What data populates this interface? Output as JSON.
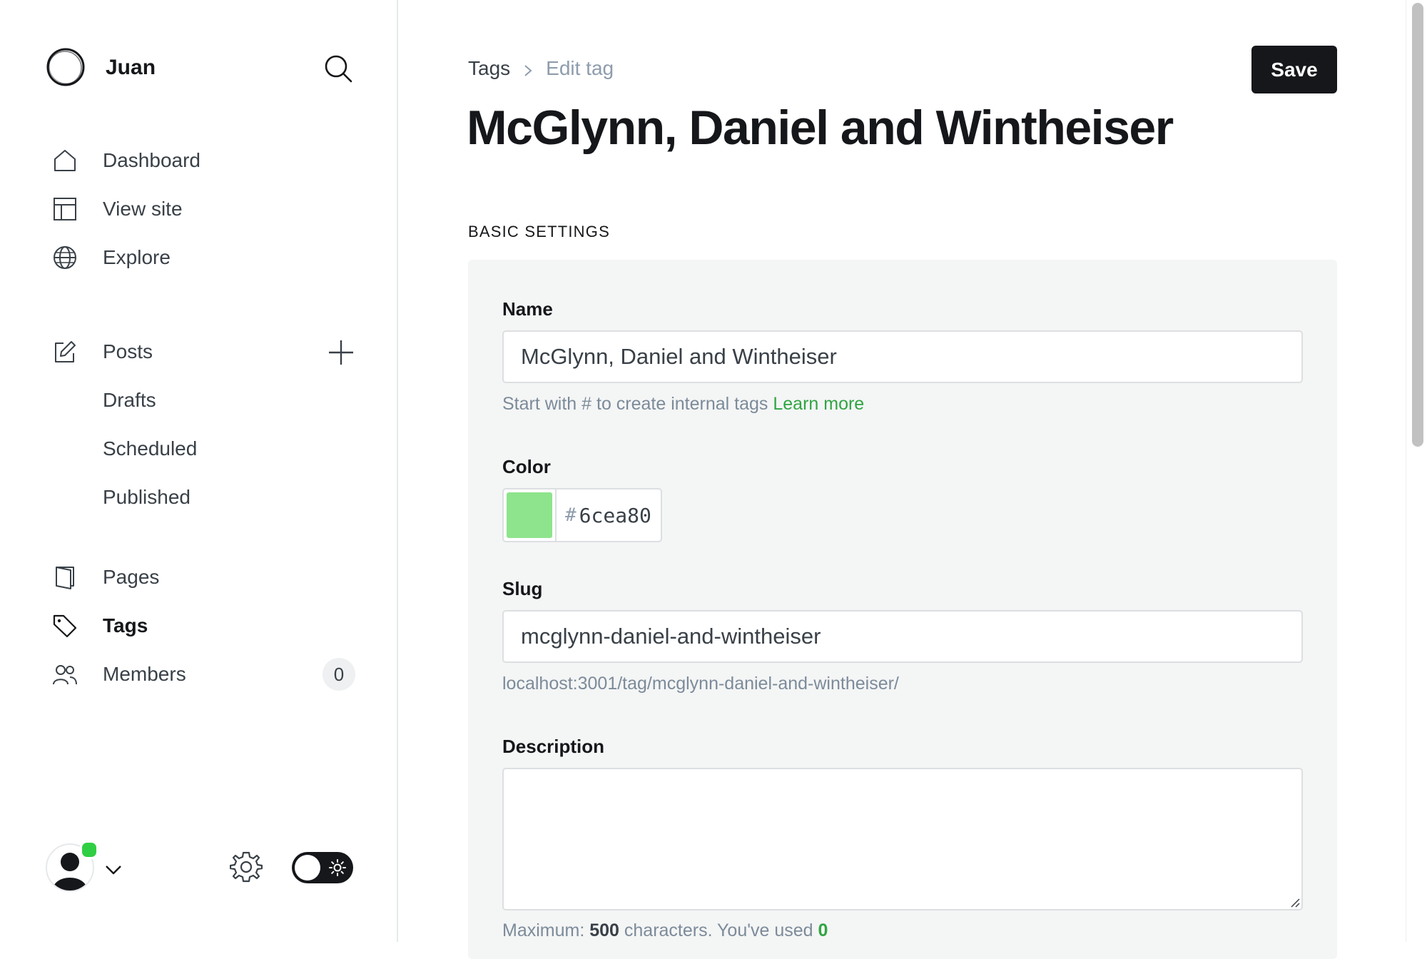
{
  "site": {
    "name": "Juan"
  },
  "nav": {
    "dashboard": "Dashboard",
    "view_site": "View site",
    "explore": "Explore",
    "posts": "Posts",
    "drafts": "Drafts",
    "scheduled": "Scheduled",
    "published": "Published",
    "pages": "Pages",
    "tags": "Tags",
    "members": "Members",
    "members_count": "0"
  },
  "breadcrumb": {
    "parent": "Tags",
    "current": "Edit tag"
  },
  "header": {
    "save_label": "Save",
    "title": "McGlynn, Daniel and Wintheiser"
  },
  "section": {
    "title": "BASIC SETTINGS"
  },
  "form": {
    "name_label": "Name",
    "name_value": "McGlynn, Daniel and Wintheiser",
    "name_hint": "Start with # to create internal tags ",
    "name_hint_link": "Learn more",
    "color_label": "Color",
    "color_hash": "#",
    "color_value": "6cea80",
    "slug_label": "Slug",
    "slug_value": "mcglynn-daniel-and-wintheiser",
    "slug_url": "localhost:3001/tag/mcglynn-daniel-and-wintheiser/",
    "description_label": "Description",
    "description_value": "",
    "max_prefix": "Maximum: ",
    "max_value": "500",
    "max_mid": " characters. You've used ",
    "used_value": "0"
  },
  "colors": {
    "tag_color": "#8de48c",
    "accent_green": "#30cf43",
    "primary_dark": "#15171a"
  }
}
